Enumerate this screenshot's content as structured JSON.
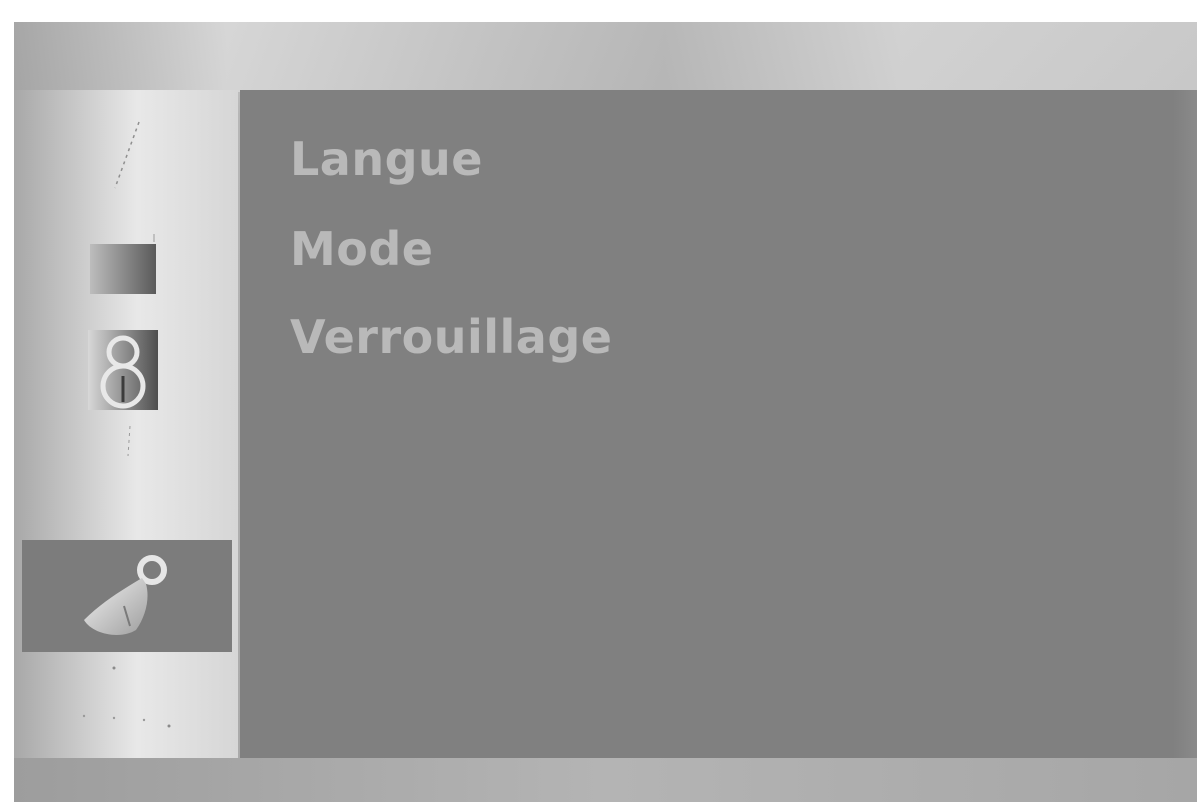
{
  "osd_menu": {
    "sidebar": {
      "items": [
        {
          "id": "picture",
          "icon": "picture-icon"
        },
        {
          "id": "sound",
          "icon": "speaker-icon"
        },
        {
          "id": "time",
          "icon": "clock-icon"
        },
        {
          "id": "options",
          "icon": "key-tag-icon",
          "selected": true
        }
      ]
    },
    "submenu": {
      "items": [
        {
          "label": "Langue"
        },
        {
          "label": "Mode"
        },
        {
          "label": "Verrouillage"
        }
      ]
    }
  },
  "colors": {
    "panel_background": "#808080",
    "menu_text": "#b9b9b9",
    "selected_item": "#7c7c7c"
  }
}
